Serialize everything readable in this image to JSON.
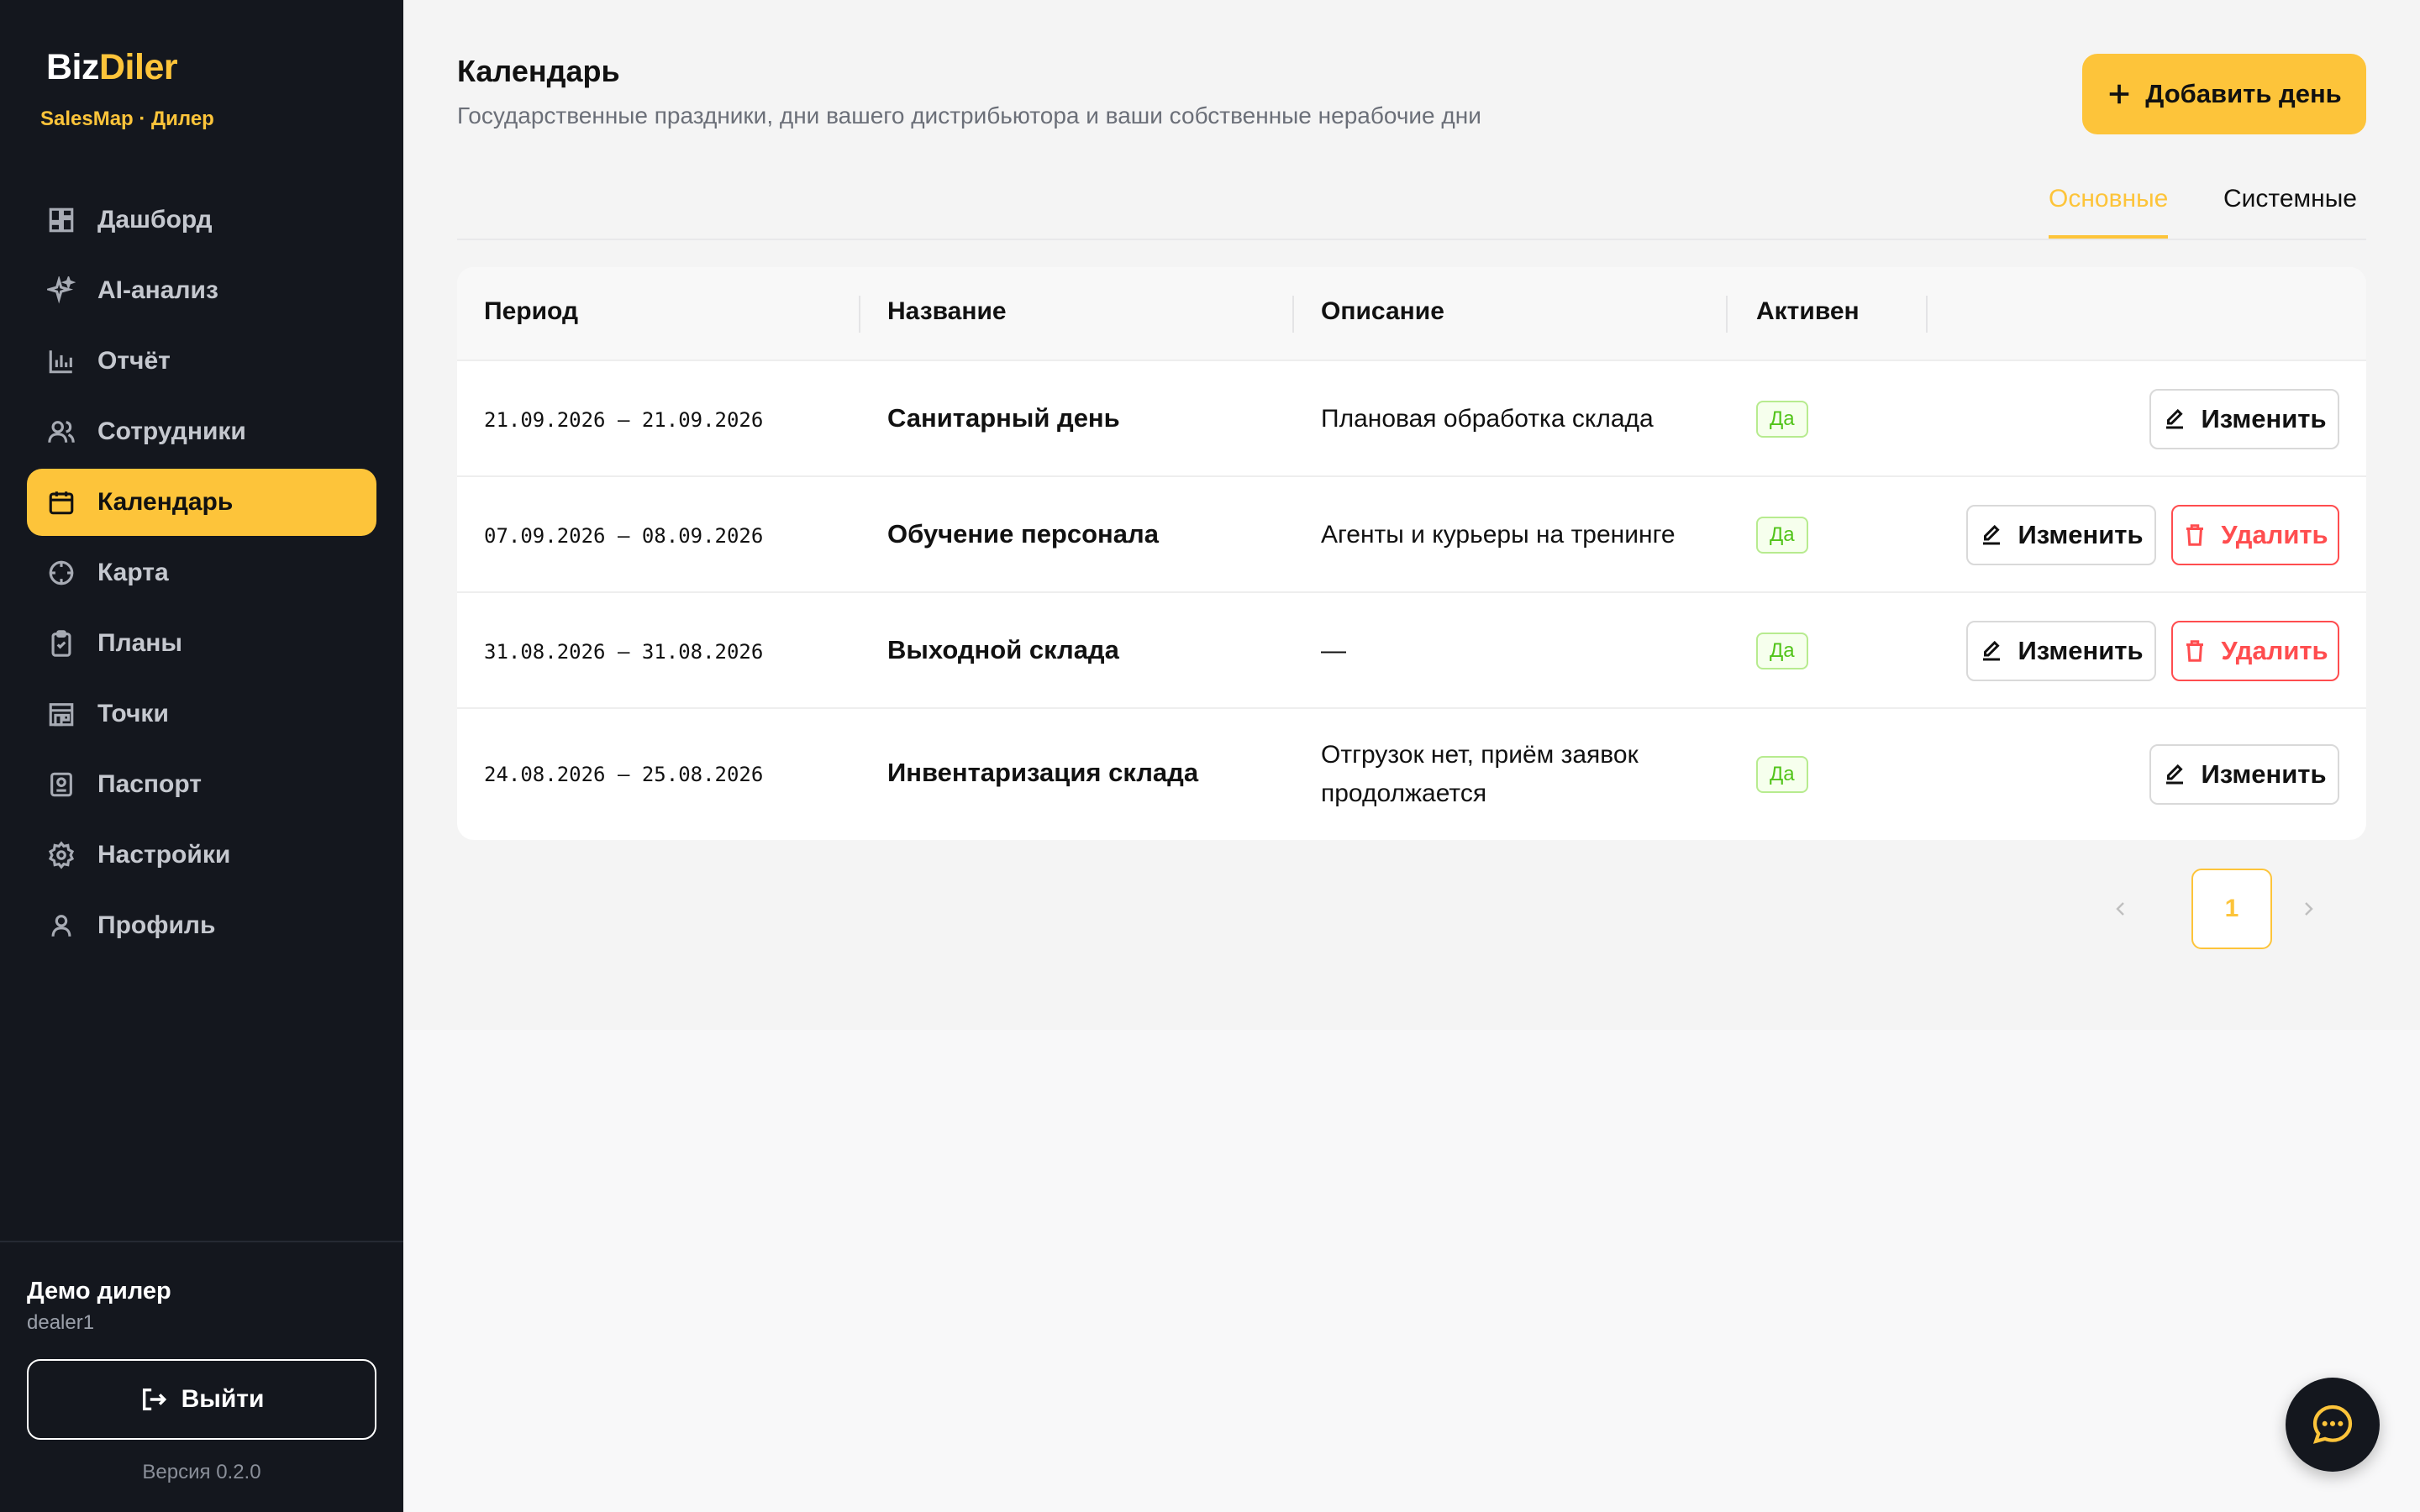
{
  "brand": {
    "part1": "Biz",
    "part2": "Diler",
    "subtitle": "SalesMap · Дилер"
  },
  "sidebar": {
    "items": [
      {
        "label": "Дашборд",
        "icon": "dashboard-icon"
      },
      {
        "label": "AI-анализ",
        "icon": "sparkle-icon"
      },
      {
        "label": "Отчёт",
        "icon": "bar-chart-icon"
      },
      {
        "label": "Сотрудники",
        "icon": "users-icon"
      },
      {
        "label": "Календарь",
        "icon": "calendar-icon",
        "active": true
      },
      {
        "label": "Карта",
        "icon": "map-target-icon"
      },
      {
        "label": "Планы",
        "icon": "clipboard-icon"
      },
      {
        "label": "Точки",
        "icon": "store-icon"
      },
      {
        "label": "Паспорт",
        "icon": "passport-icon"
      },
      {
        "label": "Настройки",
        "icon": "gear-icon"
      },
      {
        "label": "Профиль",
        "icon": "user-icon"
      }
    ]
  },
  "user": {
    "name": "Демо дилер",
    "login": "dealer1"
  },
  "logout_label": "Выйти",
  "version": "Версия 0.2.0",
  "page": {
    "title": "Календарь",
    "subtitle": "Государственные праздники, дни вашего дистрибьютора и ваши собственные нерабочие дни",
    "add_label": "Добавить день"
  },
  "tabs": {
    "main": "Основные",
    "system": "Системные"
  },
  "table": {
    "headers": {
      "period": "Период",
      "name": "Название",
      "description": "Описание",
      "active": "Активен"
    },
    "rows": [
      {
        "period": "21.09.2026 — 21.09.2026",
        "name": "Санитарный день",
        "description": "Плановая обработка склада",
        "active": "Да"
      },
      {
        "period": "07.09.2026 — 08.09.2026",
        "name": "Обучение персонала",
        "description": "Агенты и курьеры на тренинге",
        "active": "Да"
      },
      {
        "period": "31.08.2026 — 31.08.2026",
        "name": "Выходной склада",
        "description": "—",
        "active": "Да"
      },
      {
        "period": "24.08.2026 — 25.08.2026",
        "name": "Инвентаризация склада",
        "description": "Отгрузок нет, приём заявок продолжается",
        "active": "Да"
      }
    ],
    "edit_label": "Изменить",
    "delete_label": "Удалить"
  },
  "pagination": {
    "current": "1"
  },
  "colors": {
    "accent": "#fdc43a",
    "sidebar_bg": "#14171e",
    "success": "#52c41a",
    "danger": "#ff4d4f"
  }
}
